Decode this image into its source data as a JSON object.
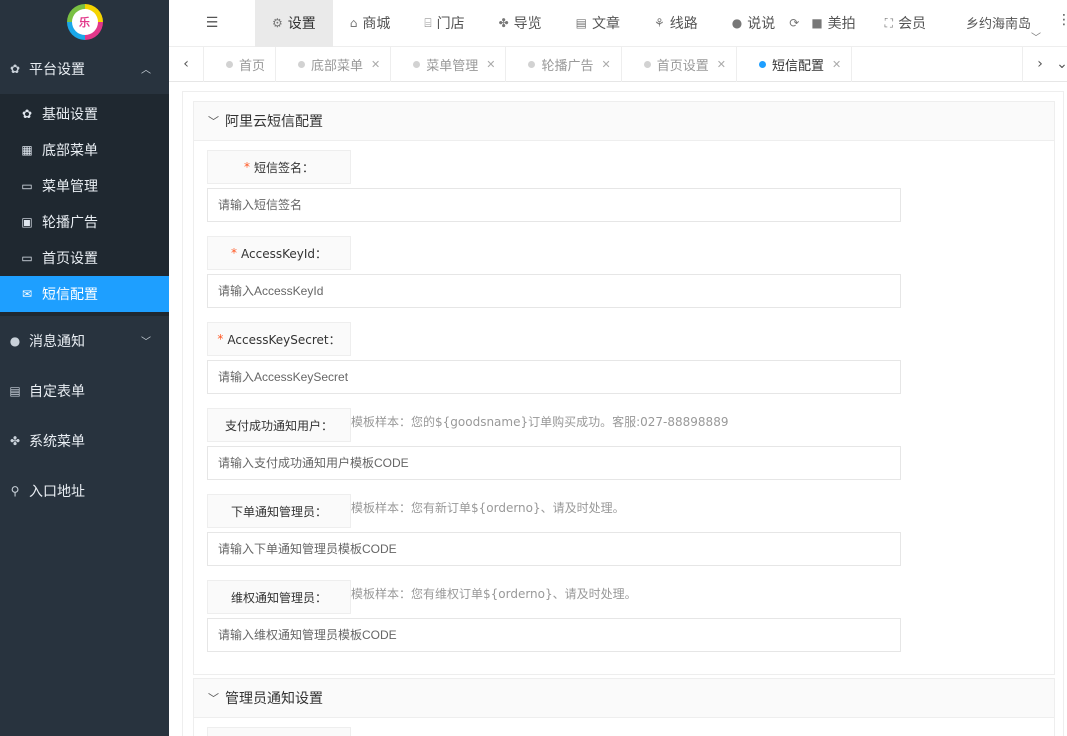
{
  "sidebar": {
    "logo_text": "乐",
    "groups": [
      {
        "label": "平台设置",
        "icon": "gear-icon",
        "expanded": true
      },
      {
        "label": "消息通知",
        "icon": "chat-icon",
        "expanded": false
      },
      {
        "label": "自定表单",
        "icon": "form-icon"
      },
      {
        "label": "系统菜单",
        "icon": "cubes-icon"
      },
      {
        "label": "入口地址",
        "icon": "search-icon"
      }
    ],
    "submenu": [
      {
        "label": "基础设置",
        "icon": "gear-icon"
      },
      {
        "label": "底部菜单",
        "icon": "grid-icon"
      },
      {
        "label": "菜单管理",
        "icon": "monitor-icon"
      },
      {
        "label": "轮播广告",
        "icon": "image-icon"
      },
      {
        "label": "首页设置",
        "icon": "monitor-icon"
      },
      {
        "label": "短信配置",
        "icon": "mail-icon",
        "active": true
      }
    ]
  },
  "topbar": {
    "nav": [
      {
        "label": "设置",
        "icon": "gears-icon",
        "active": true
      },
      {
        "label": "商城",
        "icon": "shop-icon"
      },
      {
        "label": "门店",
        "icon": "bank-icon"
      },
      {
        "label": "导览",
        "icon": "cubes-icon"
      },
      {
        "label": "文章",
        "icon": "newspaper-icon"
      },
      {
        "label": "线路",
        "icon": "route-icon"
      },
      {
        "label": "说说",
        "icon": "wechat-icon"
      },
      {
        "label": "美拍",
        "icon": "video-icon"
      },
      {
        "label": "会员",
        "icon": "users-icon"
      }
    ],
    "user_name": "乡约海南岛"
  },
  "tabs": [
    {
      "label": "首页",
      "closable": false
    },
    {
      "label": "底部菜单",
      "closable": true
    },
    {
      "label": "菜单管理",
      "closable": true
    },
    {
      "label": "轮播广告",
      "closable": true
    },
    {
      "label": "首页设置",
      "closable": true
    },
    {
      "label": "短信配置",
      "closable": true,
      "active": true
    }
  ],
  "form": {
    "section_title": "阿里云短信配置",
    "fields": [
      {
        "label": "短信签名：",
        "required": true,
        "placeholder": "请输入短信签名",
        "hint": ""
      },
      {
        "label": "AccessKeyId：",
        "required": true,
        "placeholder": "请输入AccessKeyId",
        "hint": ""
      },
      {
        "label": "AccessKeySecret：",
        "required": true,
        "placeholder": "请输入AccessKeySecret",
        "hint": ""
      },
      {
        "label": "支付成功通知用户：",
        "required": false,
        "placeholder": "请输入支付成功通知用户模板CODE",
        "hint": "模板样本：您的${goodsname}订单购买成功。客服:027-88898889"
      },
      {
        "label": "下单通知管理员：",
        "required": false,
        "placeholder": "请输入下单通知管理员模板CODE",
        "hint": "模板样本：您有新订单${orderno}、请及时处理。"
      },
      {
        "label": "维权通知管理员：",
        "required": false,
        "placeholder": "请输入维权通知管理员模板CODE",
        "hint": "模板样本：您有维权订单${orderno}、请及时处理。"
      }
    ],
    "section2_title": "管理员通知设置"
  },
  "colors": {
    "sidebar_bg": "#28333e",
    "active_blue": "#1e9fff",
    "required_star": "#ff5722"
  }
}
